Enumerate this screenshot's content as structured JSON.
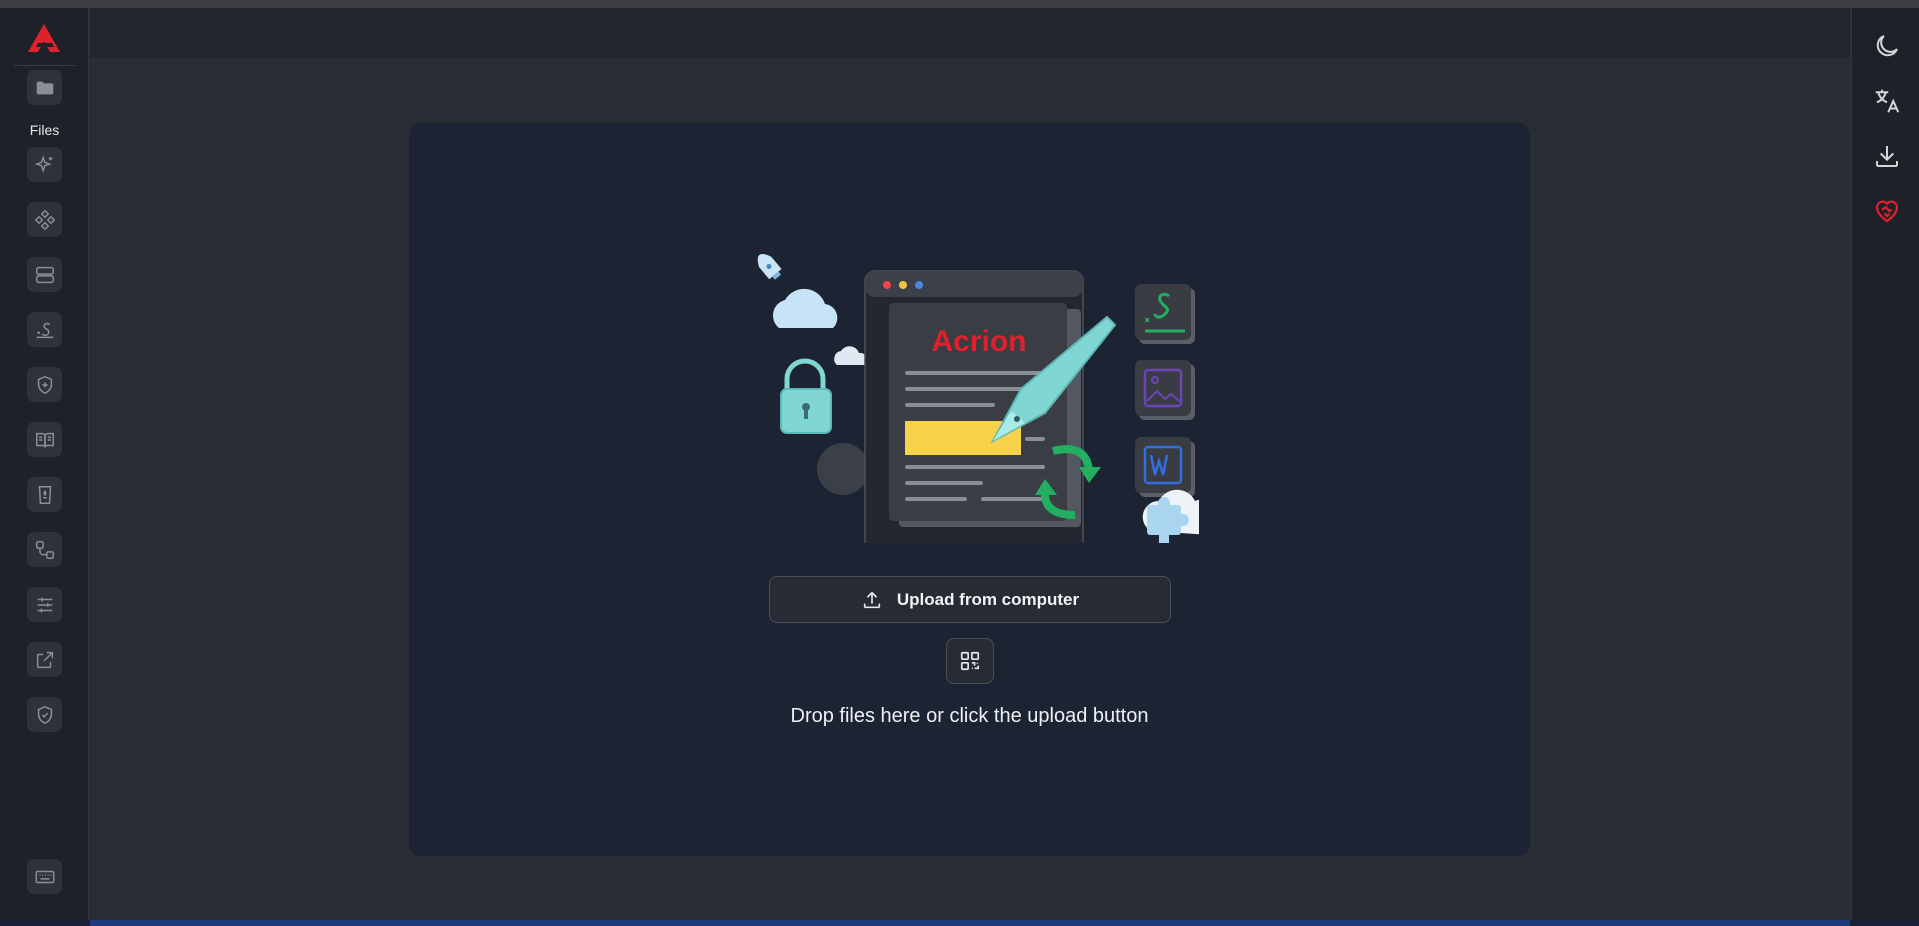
{
  "sidebar": {
    "files_label": "Files",
    "items": [
      {
        "icon": "folder-icon"
      },
      {
        "icon": "sparkles-icon"
      },
      {
        "icon": "tools-grid-icon"
      },
      {
        "icon": "stack-icon"
      },
      {
        "icon": "signature-icon"
      },
      {
        "icon": "shield-plus-icon"
      },
      {
        "icon": "book-open-icon"
      },
      {
        "icon": "wastebin-icon"
      },
      {
        "icon": "workflow-icon"
      },
      {
        "icon": "sliders-icon"
      },
      {
        "icon": "external-link-icon"
      },
      {
        "icon": "shield-check-icon"
      },
      {
        "icon": "keyboard-icon"
      }
    ]
  },
  "rightbar": {
    "items": [
      {
        "icon": "moon-icon"
      },
      {
        "icon": "translate-icon"
      },
      {
        "icon": "download-icon"
      },
      {
        "icon": "heart-handshake-icon"
      }
    ]
  },
  "dropzone": {
    "illustration_brand": "Acrion",
    "upload_label": "Upload from computer",
    "drop_text": "Drop files here or click the upload button"
  },
  "colors": {
    "brand_red": "#e0202a",
    "card_bg": "#1c2332",
    "accent_teal": "#7fd6d3",
    "accent_green": "#22b060"
  }
}
